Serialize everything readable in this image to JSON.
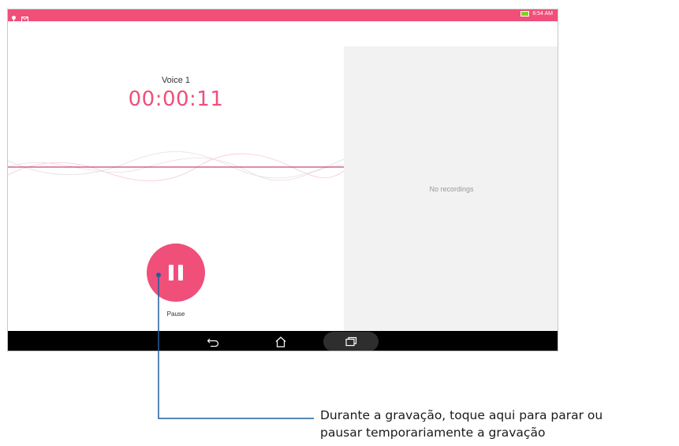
{
  "status_bar": {
    "time": "6:54 AM",
    "left_icons": [
      "notification-icon",
      "message-icon"
    ],
    "battery_icon": "battery-charging-icon"
  },
  "recorder": {
    "recording_name": "Voice 1",
    "elapsed_time": "00:00:11",
    "pause_label": "Pause",
    "accent_color": "#f04f7a"
  },
  "recordings_panel": {
    "empty_text": "No recordings"
  },
  "nav_bar": {
    "buttons": [
      "back-icon",
      "home-icon",
      "recents-icon"
    ]
  },
  "callout": {
    "text": "Durante a gravação, toque aqui para parar ou\npausar temporariamente a gravação",
    "line_color": "#1f5f9f"
  }
}
